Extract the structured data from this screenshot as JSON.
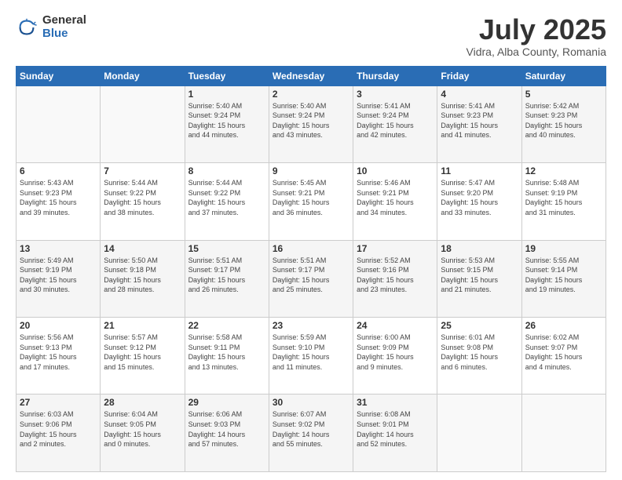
{
  "header": {
    "logo_general": "General",
    "logo_blue": "Blue",
    "month_title": "July 2025",
    "location": "Vidra, Alba County, Romania"
  },
  "days_of_week": [
    "Sunday",
    "Monday",
    "Tuesday",
    "Wednesday",
    "Thursday",
    "Friday",
    "Saturday"
  ],
  "weeks": [
    [
      {
        "day": "",
        "info": ""
      },
      {
        "day": "",
        "info": ""
      },
      {
        "day": "1",
        "info": "Sunrise: 5:40 AM\nSunset: 9:24 PM\nDaylight: 15 hours\nand 44 minutes."
      },
      {
        "day": "2",
        "info": "Sunrise: 5:40 AM\nSunset: 9:24 PM\nDaylight: 15 hours\nand 43 minutes."
      },
      {
        "day": "3",
        "info": "Sunrise: 5:41 AM\nSunset: 9:24 PM\nDaylight: 15 hours\nand 42 minutes."
      },
      {
        "day": "4",
        "info": "Sunrise: 5:41 AM\nSunset: 9:23 PM\nDaylight: 15 hours\nand 41 minutes."
      },
      {
        "day": "5",
        "info": "Sunrise: 5:42 AM\nSunset: 9:23 PM\nDaylight: 15 hours\nand 40 minutes."
      }
    ],
    [
      {
        "day": "6",
        "info": "Sunrise: 5:43 AM\nSunset: 9:23 PM\nDaylight: 15 hours\nand 39 minutes."
      },
      {
        "day": "7",
        "info": "Sunrise: 5:44 AM\nSunset: 9:22 PM\nDaylight: 15 hours\nand 38 minutes."
      },
      {
        "day": "8",
        "info": "Sunrise: 5:44 AM\nSunset: 9:22 PM\nDaylight: 15 hours\nand 37 minutes."
      },
      {
        "day": "9",
        "info": "Sunrise: 5:45 AM\nSunset: 9:21 PM\nDaylight: 15 hours\nand 36 minutes."
      },
      {
        "day": "10",
        "info": "Sunrise: 5:46 AM\nSunset: 9:21 PM\nDaylight: 15 hours\nand 34 minutes."
      },
      {
        "day": "11",
        "info": "Sunrise: 5:47 AM\nSunset: 9:20 PM\nDaylight: 15 hours\nand 33 minutes."
      },
      {
        "day": "12",
        "info": "Sunrise: 5:48 AM\nSunset: 9:19 PM\nDaylight: 15 hours\nand 31 minutes."
      }
    ],
    [
      {
        "day": "13",
        "info": "Sunrise: 5:49 AM\nSunset: 9:19 PM\nDaylight: 15 hours\nand 30 minutes."
      },
      {
        "day": "14",
        "info": "Sunrise: 5:50 AM\nSunset: 9:18 PM\nDaylight: 15 hours\nand 28 minutes."
      },
      {
        "day": "15",
        "info": "Sunrise: 5:51 AM\nSunset: 9:17 PM\nDaylight: 15 hours\nand 26 minutes."
      },
      {
        "day": "16",
        "info": "Sunrise: 5:51 AM\nSunset: 9:17 PM\nDaylight: 15 hours\nand 25 minutes."
      },
      {
        "day": "17",
        "info": "Sunrise: 5:52 AM\nSunset: 9:16 PM\nDaylight: 15 hours\nand 23 minutes."
      },
      {
        "day": "18",
        "info": "Sunrise: 5:53 AM\nSunset: 9:15 PM\nDaylight: 15 hours\nand 21 minutes."
      },
      {
        "day": "19",
        "info": "Sunrise: 5:55 AM\nSunset: 9:14 PM\nDaylight: 15 hours\nand 19 minutes."
      }
    ],
    [
      {
        "day": "20",
        "info": "Sunrise: 5:56 AM\nSunset: 9:13 PM\nDaylight: 15 hours\nand 17 minutes."
      },
      {
        "day": "21",
        "info": "Sunrise: 5:57 AM\nSunset: 9:12 PM\nDaylight: 15 hours\nand 15 minutes."
      },
      {
        "day": "22",
        "info": "Sunrise: 5:58 AM\nSunset: 9:11 PM\nDaylight: 15 hours\nand 13 minutes."
      },
      {
        "day": "23",
        "info": "Sunrise: 5:59 AM\nSunset: 9:10 PM\nDaylight: 15 hours\nand 11 minutes."
      },
      {
        "day": "24",
        "info": "Sunrise: 6:00 AM\nSunset: 9:09 PM\nDaylight: 15 hours\nand 9 minutes."
      },
      {
        "day": "25",
        "info": "Sunrise: 6:01 AM\nSunset: 9:08 PM\nDaylight: 15 hours\nand 6 minutes."
      },
      {
        "day": "26",
        "info": "Sunrise: 6:02 AM\nSunset: 9:07 PM\nDaylight: 15 hours\nand 4 minutes."
      }
    ],
    [
      {
        "day": "27",
        "info": "Sunrise: 6:03 AM\nSunset: 9:06 PM\nDaylight: 15 hours\nand 2 minutes."
      },
      {
        "day": "28",
        "info": "Sunrise: 6:04 AM\nSunset: 9:05 PM\nDaylight: 15 hours\nand 0 minutes."
      },
      {
        "day": "29",
        "info": "Sunrise: 6:06 AM\nSunset: 9:03 PM\nDaylight: 14 hours\nand 57 minutes."
      },
      {
        "day": "30",
        "info": "Sunrise: 6:07 AM\nSunset: 9:02 PM\nDaylight: 14 hours\nand 55 minutes."
      },
      {
        "day": "31",
        "info": "Sunrise: 6:08 AM\nSunset: 9:01 PM\nDaylight: 14 hours\nand 52 minutes."
      },
      {
        "day": "",
        "info": ""
      },
      {
        "day": "",
        "info": ""
      }
    ]
  ]
}
